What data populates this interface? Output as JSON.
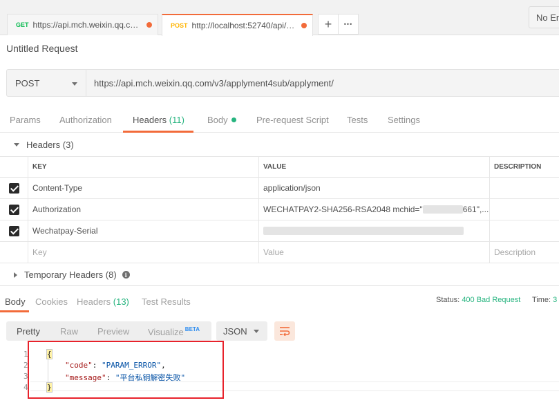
{
  "tabs": [
    {
      "method": "GET",
      "url": "https://api.mch.weixin.qq.com/..."
    },
    {
      "method": "POST",
      "url": "http://localhost:52740/api/ali/..."
    }
  ],
  "toolbar": {
    "add_label": "+",
    "more_label": "•••"
  },
  "environment": {
    "value": "No En"
  },
  "request": {
    "title": "Untitled Request",
    "method": "POST",
    "url": "https://api.mch.weixin.qq.com/v3/applyment4sub/applyment/"
  },
  "request_tabs": {
    "params": "Params",
    "authorization": "Authorization",
    "headers": "Headers",
    "headers_count": "(11)",
    "body": "Body",
    "pre_request": "Pre-request Script",
    "tests": "Tests",
    "settings": "Settings"
  },
  "headers_section": {
    "title": "Headers",
    "count": "(3)",
    "columns": {
      "key": "KEY",
      "value": "VALUE",
      "description": "DESCRIPTION"
    },
    "rows": [
      {
        "key": "Content-Type",
        "value": "application/json"
      },
      {
        "key": "Authorization",
        "value": "WECHATPAY2-SHA256-RSA2048 mchid=\"",
        "value_suffix": "661\",..."
      },
      {
        "key": "Wechatpay-Serial",
        "value": ""
      }
    ],
    "new_row": {
      "key_placeholder": "Key",
      "value_placeholder": "Value",
      "description_placeholder": "Description"
    }
  },
  "temporary_headers": {
    "title": "Temporary Headers",
    "count": "(8)"
  },
  "response_tabs": {
    "body": "Body",
    "cookies": "Cookies",
    "headers": "Headers",
    "headers_count": "(13)",
    "test_results": "Test Results"
  },
  "response_status": {
    "status_label": "Status:",
    "status_value": "400 Bad Request",
    "time_label": "Time:",
    "time_value": "3"
  },
  "view_modes": {
    "pretty": "Pretty",
    "raw": "Raw",
    "preview": "Preview",
    "visualize": "Visualize",
    "beta": "BETA"
  },
  "format": {
    "value": "JSON"
  },
  "response_body": {
    "line_numbers": [
      "1",
      "2",
      "3",
      "4"
    ],
    "open_brace": "{",
    "close_brace": "}",
    "code_key": "\"code\"",
    "code_value": "\"PARAM_ERROR\"",
    "message_key": "\"message\"",
    "message_value": "\"平台私钥解密失败\""
  },
  "colors": {
    "accent": "#f26b3a",
    "success": "#26b47f",
    "highlight": "#e8222b"
  }
}
